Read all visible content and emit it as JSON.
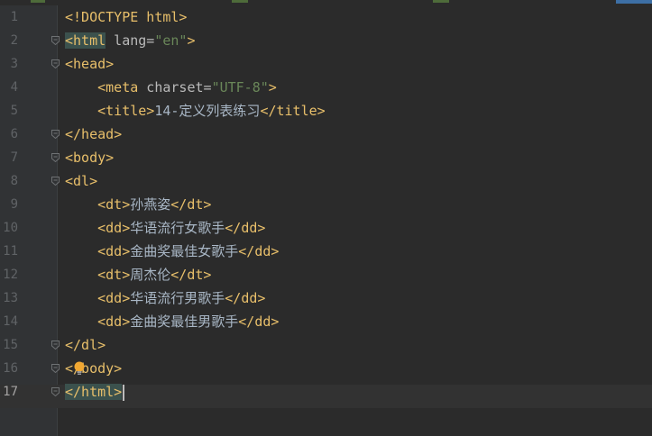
{
  "editor": {
    "current_line": "17",
    "lines": [
      {
        "n": "1",
        "parts": [
          {
            "t": "<!DOCTYPE html>",
            "c": "tag"
          }
        ]
      },
      {
        "n": "2",
        "parts": [
          {
            "t": "<html",
            "c": "tag hl"
          },
          {
            "t": " lang=",
            "c": "attr"
          },
          {
            "t": "\"en\"",
            "c": "str"
          },
          {
            "t": ">",
            "c": "tag"
          }
        ]
      },
      {
        "n": "3",
        "parts": [
          {
            "t": "<head>",
            "c": "tag"
          }
        ]
      },
      {
        "n": "4",
        "parts": [
          {
            "t": "    "
          },
          {
            "t": "<meta",
            "c": "tag"
          },
          {
            "t": " charset=",
            "c": "attr"
          },
          {
            "t": "\"UTF-8\"",
            "c": "str"
          },
          {
            "t": ">",
            "c": "tag"
          }
        ]
      },
      {
        "n": "5",
        "parts": [
          {
            "t": "    "
          },
          {
            "t": "<title>",
            "c": "tag"
          },
          {
            "t": "14-定义列表练习",
            "c": "txt"
          },
          {
            "t": "</title>",
            "c": "tag"
          }
        ]
      },
      {
        "n": "6",
        "parts": [
          {
            "t": "</head>",
            "c": "tag"
          }
        ]
      },
      {
        "n": "7",
        "parts": [
          {
            "t": "<body>",
            "c": "tag"
          }
        ]
      },
      {
        "n": "8",
        "parts": [
          {
            "t": "<dl>",
            "c": "tag"
          }
        ]
      },
      {
        "n": "9",
        "parts": [
          {
            "t": "    "
          },
          {
            "t": "<dt>",
            "c": "tag"
          },
          {
            "t": "孙燕姿",
            "c": "txt"
          },
          {
            "t": "</dt>",
            "c": "tag"
          }
        ]
      },
      {
        "n": "10",
        "parts": [
          {
            "t": "    "
          },
          {
            "t": "<dd>",
            "c": "tag"
          },
          {
            "t": "华语流行女歌手",
            "c": "txt"
          },
          {
            "t": "</dd>",
            "c": "tag"
          }
        ]
      },
      {
        "n": "11",
        "parts": [
          {
            "t": "    "
          },
          {
            "t": "<dd>",
            "c": "tag"
          },
          {
            "t": "金曲奖最佳女歌手",
            "c": "txt"
          },
          {
            "t": "</dd>",
            "c": "tag"
          }
        ]
      },
      {
        "n": "12",
        "parts": [
          {
            "t": "    "
          },
          {
            "t": "<dt>",
            "c": "tag"
          },
          {
            "t": "周杰伦",
            "c": "txt"
          },
          {
            "t": "</dt>",
            "c": "tag"
          }
        ]
      },
      {
        "n": "13",
        "parts": [
          {
            "t": "    "
          },
          {
            "t": "<dd>",
            "c": "tag"
          },
          {
            "t": "华语流行男歌手",
            "c": "txt"
          },
          {
            "t": "</dd>",
            "c": "tag"
          }
        ]
      },
      {
        "n": "14",
        "parts": [
          {
            "t": "    "
          },
          {
            "t": "<dd>",
            "c": "tag"
          },
          {
            "t": "金曲奖最佳男歌手",
            "c": "txt"
          },
          {
            "t": "</dd>",
            "c": "tag"
          }
        ]
      },
      {
        "n": "15",
        "parts": [
          {
            "t": "</dl>",
            "c": "tag"
          }
        ]
      },
      {
        "n": "16",
        "parts": [
          {
            "t": "</body>",
            "c": "tag"
          }
        ]
      },
      {
        "n": "17",
        "parts": [
          {
            "t": "</html>",
            "c": "tag hl"
          }
        ]
      }
    ],
    "fold_lines": [
      "2",
      "3",
      "6",
      "7",
      "8",
      "15",
      "16",
      "17"
    ],
    "intention_line": "16",
    "colors": {
      "tag": "#e8bf6a",
      "attribute": "#bababa",
      "string": "#6a8759",
      "text": "#a9b7c6",
      "background": "#2b2b2b",
      "gutter": "#313335"
    }
  }
}
